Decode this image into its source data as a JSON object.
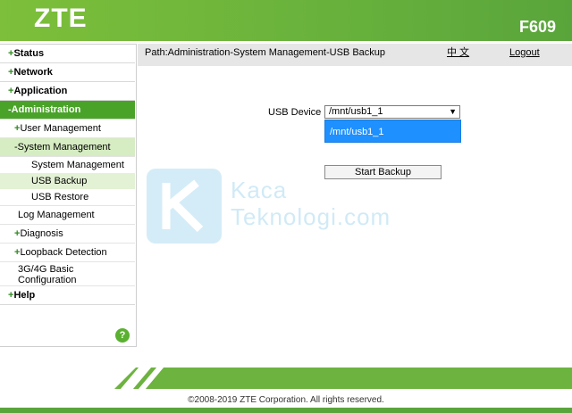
{
  "header": {
    "logo": "ZTE",
    "model": "F609"
  },
  "path": {
    "text": "Path:Administration-System Management-USB Backup",
    "lang": "中 文",
    "logout": "Logout"
  },
  "nav": {
    "status": "Status",
    "network": "Network",
    "application": "Application",
    "administration": "Administration",
    "user_management": "User Management",
    "system_management": "System Management",
    "sub_system_management": "System Management",
    "usb_backup": "USB Backup",
    "usb_restore": "USB Restore",
    "log_management": "Log Management",
    "diagnosis": "Diagnosis",
    "loopback_detection": "Loopback Detection",
    "config_3g4g_line1": "3G/4G Basic",
    "config_3g4g_line2": "Configuration",
    "help": "Help",
    "help_icon": "?"
  },
  "form": {
    "usb_device_label": "USB Device",
    "usb_device_value": "/mnt/usb1_1",
    "dropdown_option": "/mnt/usb1_1",
    "start_backup": "Start Backup"
  },
  "watermark": {
    "line1": "Kaca",
    "line2": "Teknologi.com"
  },
  "footer": {
    "copyright": "©2008-2019 ZTE Corporation. All rights reserved."
  },
  "colors": {
    "brand_green": "#6cb33f",
    "active_nav": "#4aa329",
    "dropdown_highlight": "#1e90ff"
  }
}
